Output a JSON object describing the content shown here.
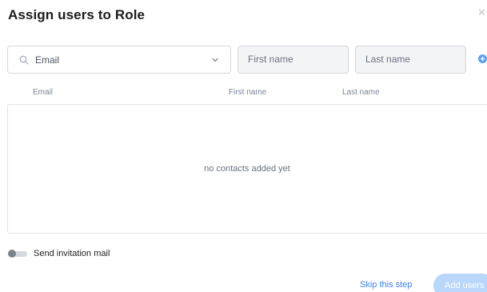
{
  "dialog": {
    "title": "Assign users to Role",
    "close_icon": "close-icon"
  },
  "form": {
    "email_select_value": "Email",
    "email_search_icon": "search-icon",
    "email_chevron_icon": "chevron-down-icon",
    "first_name_placeholder": "First name",
    "last_name_placeholder": "Last name",
    "add_icon": "plus-circle-icon"
  },
  "table": {
    "columns": [
      "Email",
      "First name",
      "Last name"
    ],
    "empty_text": "no contacts added yet"
  },
  "invitation": {
    "label": "Send invitation mail",
    "enabled": false
  },
  "footer": {
    "skip_label": "Skip this step",
    "add_label": "Add users"
  },
  "colors": {
    "accent": "#3b82f6",
    "primary_button_disabled": "#b9d6fb"
  }
}
